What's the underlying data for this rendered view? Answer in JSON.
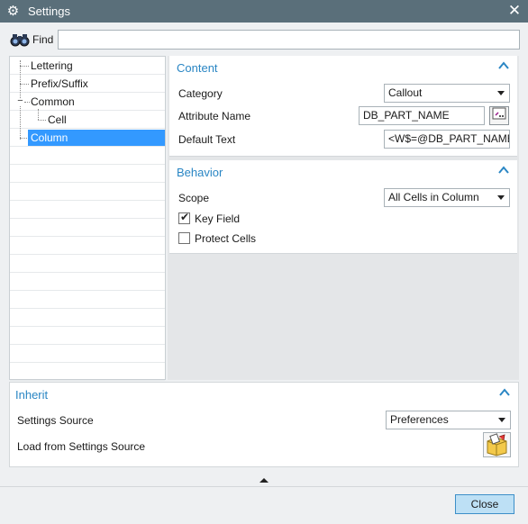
{
  "window": {
    "title": "Settings",
    "gear_icon": "gear-icon",
    "close_icon": "close-icon"
  },
  "find": {
    "label": "Find",
    "value": ""
  },
  "tree": {
    "items": [
      {
        "label": "Lettering"
      },
      {
        "label": "Prefix/Suffix"
      },
      {
        "label": "Common",
        "expanded": true
      },
      {
        "label": "Cell"
      },
      {
        "label": "Column",
        "selected": true
      }
    ]
  },
  "content": {
    "heading": "Content",
    "category_label": "Category",
    "category_value": "Callout",
    "attribute_label": "Attribute Name",
    "attribute_value": "DB_PART_NAME",
    "attribute_button": "...",
    "default_label": "Default Text",
    "default_value": "<W$=@DB_PART_NAME"
  },
  "behavior": {
    "heading": "Behavior",
    "scope_label": "Scope",
    "scope_value": "All Cells in Column",
    "keyfield_label": "Key Field",
    "keyfield_checked": true,
    "protect_label": "Protect Cells",
    "protect_checked": false
  },
  "inherit": {
    "heading": "Inherit",
    "source_label": "Settings Source",
    "source_value": "Preferences",
    "load_label": "Load from Settings Source"
  },
  "footer": {
    "close_label": "Close"
  },
  "colors": {
    "accent": "#2a86c4",
    "titlebar": "#5a6f7a",
    "selection": "#3399ff"
  }
}
